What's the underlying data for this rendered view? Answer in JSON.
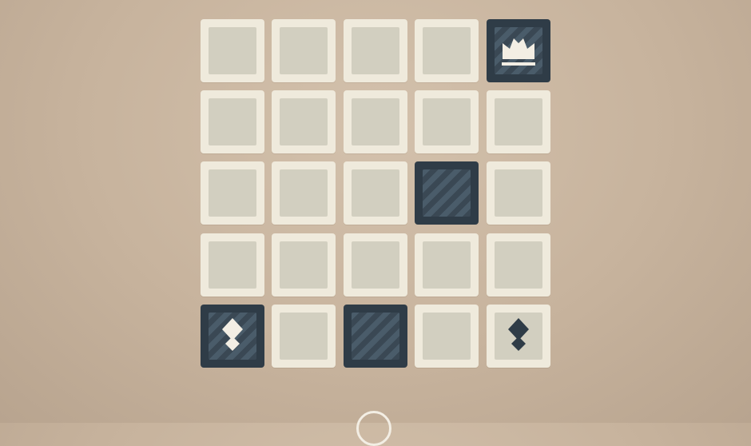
{
  "board": {
    "rows": 5,
    "cols": 5,
    "tiles": [
      [
        "empty",
        "empty",
        "empty",
        "empty",
        "goal"
      ],
      [
        "empty",
        "empty",
        "empty",
        "empty",
        "empty"
      ],
      [
        "empty",
        "empty",
        "empty",
        "blocked",
        "empty"
      ],
      [
        "empty",
        "empty",
        "empty",
        "empty",
        "empty"
      ],
      [
        "player",
        "empty",
        "blocked",
        "empty",
        "enemy"
      ]
    ]
  },
  "colors": {
    "background": "#cdb9a3",
    "tile_light": "#efeadc",
    "tile_inner": "#d2cfc0",
    "tile_dark": "#2f3c47",
    "stripe": "#4a5c6a",
    "piece_light": "#f3eee4",
    "piece_dark": "#2f3c47"
  },
  "icons": {
    "goal": "crown-icon",
    "player": "diamond-piece-icon",
    "enemy": "diamond-piece-icon"
  }
}
